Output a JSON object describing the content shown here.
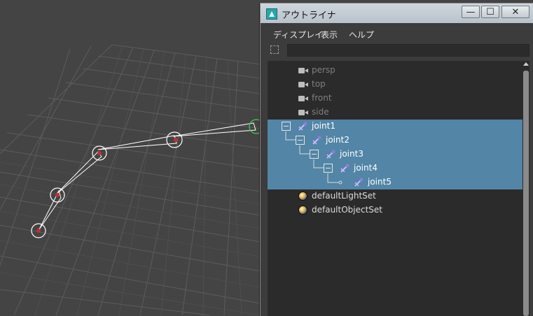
{
  "window": {
    "title": "アウトライナ",
    "buttons": {
      "minimize": "—",
      "maximize": "☐",
      "close": "✕"
    }
  },
  "menubar": [
    "ディスプレイ",
    "表示",
    "ヘルプ"
  ],
  "filter": {
    "value": "",
    "placeholder": ""
  },
  "outliner_items": [
    {
      "label": "persp",
      "icon": "camera-icon",
      "state": "dim"
    },
    {
      "label": "top",
      "icon": "camera-icon",
      "state": "dim"
    },
    {
      "label": "front",
      "icon": "camera-icon",
      "state": "dim"
    },
    {
      "label": "side",
      "icon": "camera-icon",
      "state": "dim"
    },
    {
      "label": "joint1",
      "icon": "joint-icon",
      "state": "selected",
      "depth": 0,
      "expanded": true
    },
    {
      "label": "joint2",
      "icon": "joint-icon",
      "state": "selected",
      "depth": 1,
      "expanded": true
    },
    {
      "label": "joint3",
      "icon": "joint-icon",
      "state": "selected",
      "depth": 2,
      "expanded": true
    },
    {
      "label": "joint4",
      "icon": "joint-icon",
      "state": "selected",
      "depth": 3,
      "expanded": true
    },
    {
      "label": "joint5",
      "icon": "joint-icon",
      "state": "selected",
      "depth": 4
    },
    {
      "label": "defaultLightSet",
      "icon": "set-icon",
      "state": "normal"
    },
    {
      "label": "defaultObjectSet",
      "icon": "set-icon",
      "state": "normal"
    }
  ],
  "colors": {
    "selection": "#5285a6",
    "viewport_bg": "#444444",
    "grid": "#5a5a5a",
    "joint_highlight": "#3cd24a"
  }
}
